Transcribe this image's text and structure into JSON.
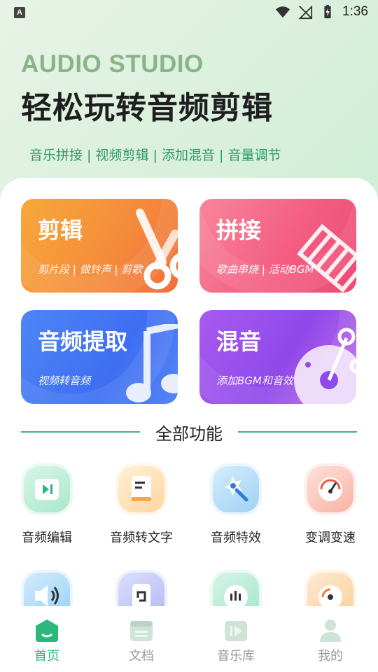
{
  "status_bar": {
    "time": "1:36",
    "left_icon_letter": "A"
  },
  "header": {
    "brand": "AUDIO STUDIO",
    "headline": "轻松玩转音频剪辑",
    "tagline": "音乐拼接 | 视频剪辑 | 添加混音 | 音量调节"
  },
  "cards": [
    {
      "title": "剪辑",
      "subtitle": "剪片段 | 做铃声 | 剪歌",
      "icon": "scissors-icon"
    },
    {
      "title": "拼接",
      "subtitle": "歌曲串烧 | 活动BGM",
      "icon": "splice-icon"
    },
    {
      "title": "音频提取",
      "subtitle": "视频转音频",
      "icon": "music-note-icon"
    },
    {
      "title": "混音",
      "subtitle": "添加BGM和音效",
      "icon": "disc-icon"
    }
  ],
  "section": {
    "title": "全部功能"
  },
  "functions": [
    {
      "label": "音频编辑",
      "icon": "audio-edit-icon"
    },
    {
      "label": "音频转文字",
      "icon": "audio-to-text-icon"
    },
    {
      "label": "音频特效",
      "icon": "audio-effect-icon"
    },
    {
      "label": "变调变速",
      "icon": "speed-gauge-icon"
    }
  ],
  "functions_row2_icons": [
    "volume-icon",
    "rotate-icon",
    "waveform-icon",
    "disc-record-icon"
  ],
  "bottom_nav": [
    {
      "label": "首页",
      "icon": "home-icon",
      "active": true
    },
    {
      "label": "文档",
      "icon": "document-icon",
      "active": false
    },
    {
      "label": "音乐库",
      "icon": "music-library-icon",
      "active": false
    },
    {
      "label": "我的",
      "icon": "profile-icon",
      "active": false
    }
  ],
  "colors": {
    "accent": "#2cb77c",
    "brand_text": "#89b488",
    "tagline": "#2f9a66",
    "card_orange": "#f58a3b",
    "card_pink": "#f35e82",
    "card_blue": "#3f6ef2",
    "card_purple": "#8f49ea"
  }
}
